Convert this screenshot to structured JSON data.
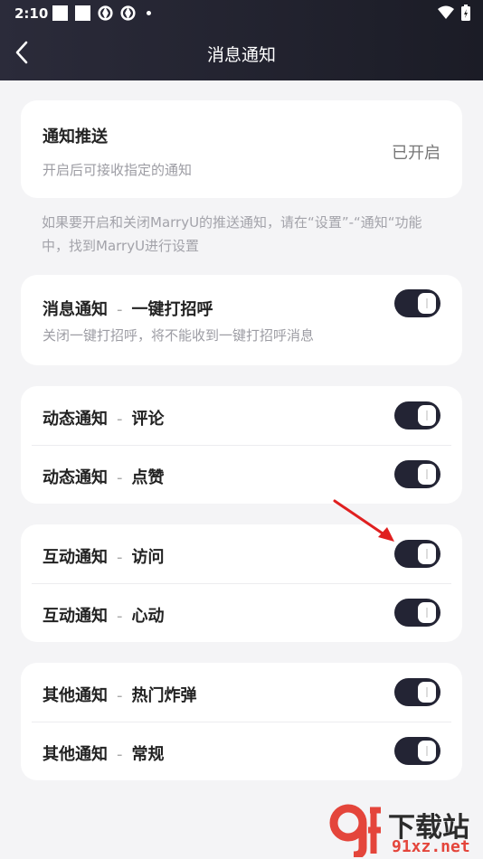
{
  "status": {
    "time": "2:10"
  },
  "header": {
    "title": "消息通知"
  },
  "push": {
    "title": "通知推送",
    "subtitle": "开启后可接收指定的通知",
    "status": "已开启"
  },
  "note": "如果要开启和关闭MarryU的推送通知，请在“设置”-“通知“功能中，找到MarryU进行设置",
  "separator": "-",
  "message_notice": {
    "category": "消息通知",
    "item": "一键打招呼",
    "desc": "关闭一键打招呼，将不能收到一键打招呼消息",
    "on": true
  },
  "groups": [
    {
      "items": [
        {
          "category": "动态通知",
          "item": "评论",
          "on": true
        },
        {
          "category": "动态通知",
          "item": "点赞",
          "on": true
        }
      ]
    },
    {
      "items": [
        {
          "category": "互动通知",
          "item": "访问",
          "on": true
        },
        {
          "category": "互动通知",
          "item": "心动",
          "on": true
        }
      ]
    },
    {
      "items": [
        {
          "category": "其他通知",
          "item": "热门炸弹",
          "on": true
        },
        {
          "category": "其他通知",
          "item": "常规",
          "on": true
        }
      ]
    }
  ],
  "watermark": {
    "brand": "下载站",
    "site": "91xz.net"
  },
  "colors": {
    "toggle_on": "#232434",
    "header_bg": "#1f2030",
    "annotation_arrow": "#e02020"
  }
}
